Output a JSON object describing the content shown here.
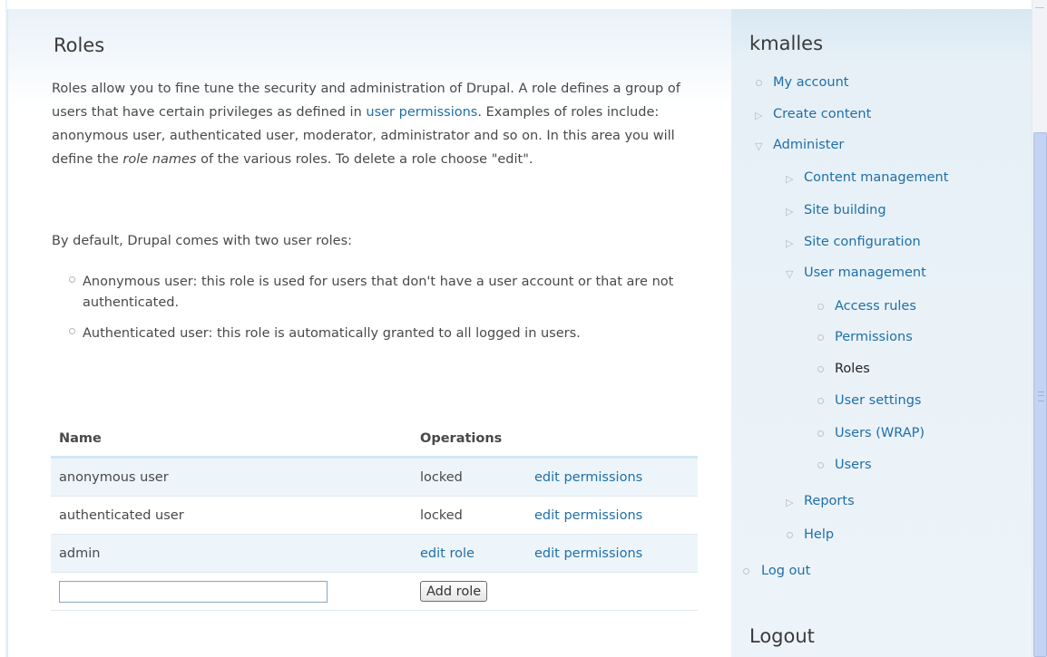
{
  "page": {
    "title": "Roles",
    "intro_1": "Roles allow you to fine tune the security and administration of Drupal. A role defines a group of users that have certain privileges as defined in ",
    "intro_link": "user permissions",
    "intro_2": ". Examples of roles include: anonymous user, authenticated user, moderator, administrator and so on. In this area you will define the ",
    "intro_em": "role names",
    "intro_3": " of the various roles. To delete a role choose \"edit\".",
    "defaults_text": "By default, Drupal comes with two user roles:",
    "bullets": [
      "Anonymous user: this role is used for users that don't have a user account or that are not authenticated.",
      "Authenticated user: this role is automatically granted to all logged in users."
    ]
  },
  "table": {
    "headers": {
      "name": "Name",
      "operations": "Operations"
    },
    "rows": [
      {
        "name": "anonymous user",
        "op1": "locked",
        "op2": "edit permissions"
      },
      {
        "name": "authenticated user",
        "op1": "locked",
        "op2": "edit permissions"
      },
      {
        "name": "admin",
        "op1": "edit role",
        "op2": "edit permissions"
      }
    ],
    "new_role_value": "",
    "add_button": "Add role"
  },
  "sidebar": {
    "user_title": "kmalles",
    "nav": {
      "my_account": "My account",
      "create_content": "Create content",
      "administer": "Administer",
      "content_management": "Content management",
      "site_building": "Site building",
      "site_configuration": "Site configuration",
      "user_management": "User management",
      "access_rules": "Access rules",
      "permissions": "Permissions",
      "roles": "Roles",
      "user_settings": "User settings",
      "users_wrap": "Users (WRAP)",
      "users": "Users",
      "reports": "Reports",
      "help": "Help",
      "log_out": "Log out"
    },
    "logout_title": "Logout"
  },
  "colors": {
    "link": "#1f6fa8",
    "sidebar_bg": "#e7f0f7",
    "table_odd_row": "#edf5fa",
    "scroll_thumb": "#c3d3f4"
  }
}
